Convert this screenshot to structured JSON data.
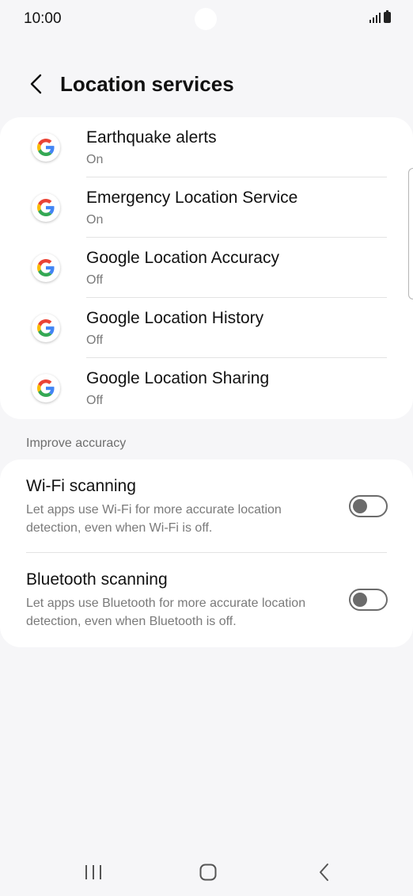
{
  "status_bar": {
    "time": "10:00"
  },
  "header": {
    "title": "Location services",
    "back_icon": "chevron-left-icon"
  },
  "services": [
    {
      "title": "Earthquake alerts",
      "status": "On",
      "icon": "google-g-icon"
    },
    {
      "title": "Emergency Location Service",
      "status": "On",
      "icon": "google-g-icon"
    },
    {
      "title": "Google Location Accuracy",
      "status": "Off",
      "icon": "google-g-icon"
    },
    {
      "title": "Google Location History",
      "status": "Off",
      "icon": "google-g-icon"
    },
    {
      "title": "Google Location Sharing",
      "status": "Off",
      "icon": "google-g-icon"
    }
  ],
  "improve_accuracy": {
    "section_title": "Improve accuracy",
    "wifi": {
      "title": "Wi-Fi scanning",
      "description": "Let apps use Wi-Fi for more accurate location detection, even when Wi-Fi is off.",
      "enabled": false
    },
    "bluetooth": {
      "title": "Bluetooth scanning",
      "description": "Let apps use Bluetooth for more accurate location detection, even when Bluetooth is off.",
      "enabled": false
    }
  },
  "colors": {
    "background": "#f6f6f8",
    "card": "#ffffff",
    "toggle_off": "#6b6b6b",
    "google_blue": "#4285F4",
    "google_red": "#EA4335",
    "google_yellow": "#FBBC05",
    "google_green": "#34A853"
  }
}
